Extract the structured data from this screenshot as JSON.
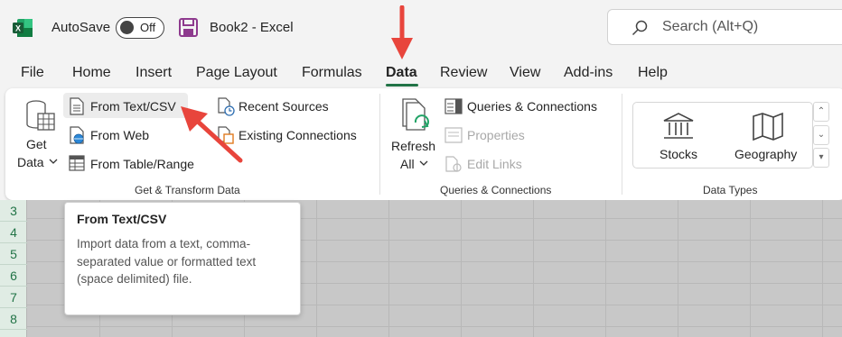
{
  "titlebar": {
    "autosave_label": "AutoSave",
    "autosave_state": "Off",
    "document_title": "Book2  -  Excel",
    "search_placeholder": "Search (Alt+Q)"
  },
  "tabs": [
    {
      "label": "File"
    },
    {
      "label": "Home"
    },
    {
      "label": "Insert"
    },
    {
      "label": "Page Layout"
    },
    {
      "label": "Formulas"
    },
    {
      "label": "Data",
      "active": true
    },
    {
      "label": "Review"
    },
    {
      "label": "View"
    },
    {
      "label": "Add-ins"
    },
    {
      "label": "Help"
    }
  ],
  "ribbon": {
    "get_transform": {
      "get_data_line1": "Get",
      "get_data_line2": "Data",
      "from_text_csv": "From Text/CSV",
      "from_web": "From Web",
      "from_table_range": "From Table/Range",
      "recent_sources": "Recent Sources",
      "existing_connections": "Existing Connections",
      "group_label": "Get & Transform Data"
    },
    "queries": {
      "refresh_line1": "Refresh",
      "refresh_line2": "All",
      "queries_connections": "Queries & Connections",
      "properties": "Properties",
      "edit_links": "Edit Links",
      "group_label": "Queries & Connections"
    },
    "data_types": {
      "stocks": "Stocks",
      "geography": "Geography",
      "group_label": "Data Types"
    }
  },
  "sheet": {
    "row_numbers": [
      "3",
      "4",
      "5",
      "6",
      "7",
      "8"
    ]
  },
  "tooltip": {
    "title": "From Text/CSV",
    "body": "Import data from a text, comma-separated value or formatted text (space delimited) file."
  },
  "colors": {
    "excel_green": "#217346",
    "annotation_red": "#e8453c",
    "save_purple": "#8e3a8e"
  }
}
